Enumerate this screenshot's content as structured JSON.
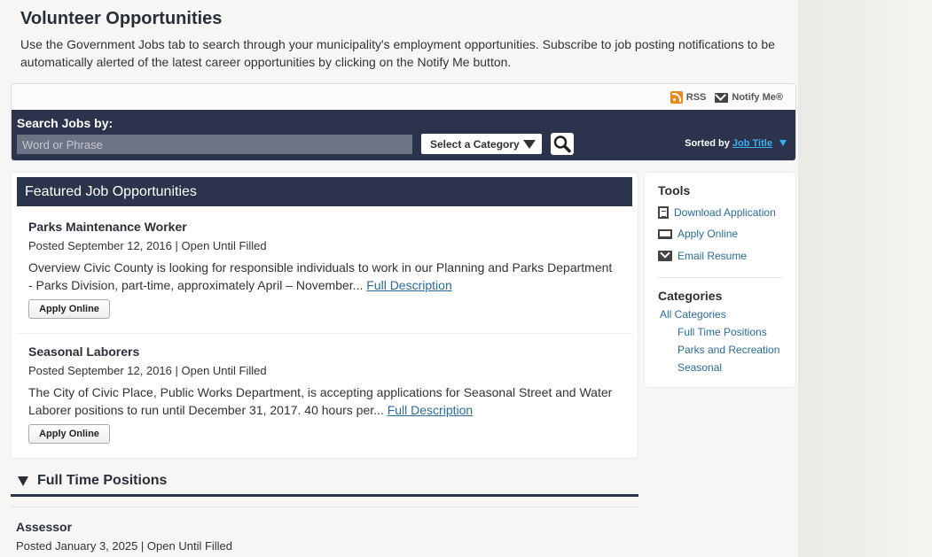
{
  "page": {
    "title": "Volunteer Opportunities",
    "intro": "Use the Government Jobs tab to search through your municipality's employment opportunities. Subscribe to job posting notifications to be automatically alerted of the latest career opportunities by clicking on the Notify Me button."
  },
  "panel": {
    "rss_label": "RSS",
    "notify_label": "Notify Me®"
  },
  "search": {
    "label": "Search Jobs by:",
    "placeholder": "Word or Phrase",
    "category_label": "Select a Category",
    "sorted_prefix": "Sorted by",
    "sorted_value": "Job Title"
  },
  "featured": {
    "heading": "Featured Job Opportunities",
    "jobs": [
      {
        "title": "Parks Maintenance Worker",
        "meta": "Posted September 12, 2016 | Open Until Filled",
        "desc": "Overview Civic County is looking for responsible individuals to work in our Planning and Parks Department - Parks Division, part-time, approximately April – November...",
        "link": "Full Description",
        "apply": "Apply Online"
      },
      {
        "title": "Seasonal Laborers",
        "meta": "Posted September 12, 2016 | Open Until Filled",
        "desc": "The City of Civic Place, Public Works Department, is accepting applications for Seasonal Street and Water Laborer positions to run until December 31, 2017. 40 hours per...",
        "link": "Full Description",
        "apply": "Apply Online"
      }
    ]
  },
  "sidebar": {
    "tools_heading": "Tools",
    "tools": [
      "Download Application",
      "Apply Online",
      "Email Resume"
    ],
    "categories_heading": "Categories",
    "all_categories": "All Categories",
    "categories": [
      "Full Time Positions",
      "Parks and Recreation",
      "Seasonal"
    ]
  },
  "section": {
    "title": "Full Time Positions",
    "job_title": "Assessor",
    "job_meta": "Posted January 3, 2025 | Open Until Filled"
  }
}
